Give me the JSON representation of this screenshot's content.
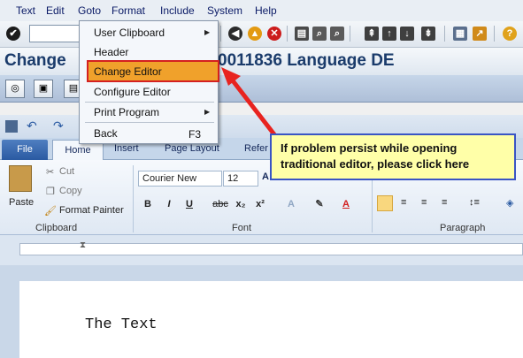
{
  "menubar": {
    "items": [
      "Text",
      "Edit",
      "Goto",
      "Format",
      "Include",
      "System",
      "Help"
    ]
  },
  "title": {
    "left": "Change",
    "right": "0011836 Language DE"
  },
  "goto_menu": {
    "items": [
      {
        "label": "User Clipboard",
        "submenu": true
      },
      {
        "label": "Header",
        "submenu": false
      },
      {
        "label": "Change Editor",
        "submenu": false,
        "highlighted": true
      },
      {
        "label": "Configure Editor",
        "submenu": false
      },
      {
        "label": "Print Program",
        "submenu": true
      },
      {
        "label": "Back",
        "submenu": false,
        "shortcut": "F3"
      }
    ]
  },
  "callout": {
    "text": "If problem persist while opening traditional editor, please click here"
  },
  "word": {
    "tabs": {
      "file": "File",
      "home": "Home",
      "insert": "Insert",
      "page_layout": "Page Layout",
      "references": "Refer"
    },
    "clipboard": {
      "paste": "Paste",
      "cut": "Cut",
      "copy": "Copy",
      "format_painter": "Format Painter",
      "group_label": "Clipboard"
    },
    "font": {
      "name": "Courier New",
      "size": "12",
      "group_label": "Font"
    },
    "paragraph": {
      "group_label": "Paragraph"
    },
    "document_text": "The Text"
  },
  "colors": {
    "highlight": "#f0a12b",
    "highlight_border": "#d42020",
    "arrow": "#e8231f",
    "callout_bg": "#ffffa8",
    "title_text": "#1a3b6b"
  }
}
